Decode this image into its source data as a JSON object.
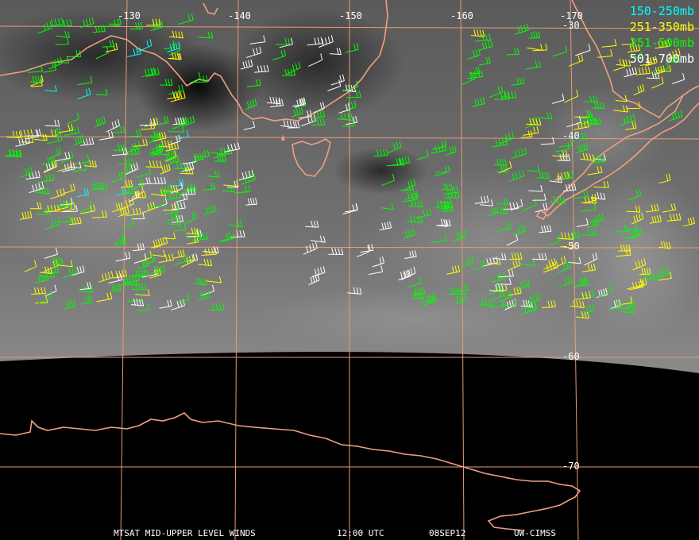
{
  "title": "MTSAT MID-UPPER LEVEL WINDS",
  "time": "12:00 UTC",
  "date": "08SEP12",
  "source": "UW-CIMSS",
  "legend": [
    {
      "label": "150-250mb",
      "color": "#00ffff"
    },
    {
      "label": "251-350mb",
      "color": "#ffff00"
    },
    {
      "label": "351-500mb",
      "color": "#00ff00"
    },
    {
      "label": "501-700mb",
      "color": "#ffffff"
    }
  ],
  "longitude_labels": [
    "-130",
    "-140",
    "-150",
    "-160",
    "-170"
  ],
  "latitude_labels": [
    "-30",
    "-40",
    "-50",
    "-60",
    "-70"
  ],
  "colors": {
    "grid": "#e89a78",
    "coast": "#f0a080",
    "cloud_bg": "#6a6a6a",
    "space": "#000000"
  }
}
